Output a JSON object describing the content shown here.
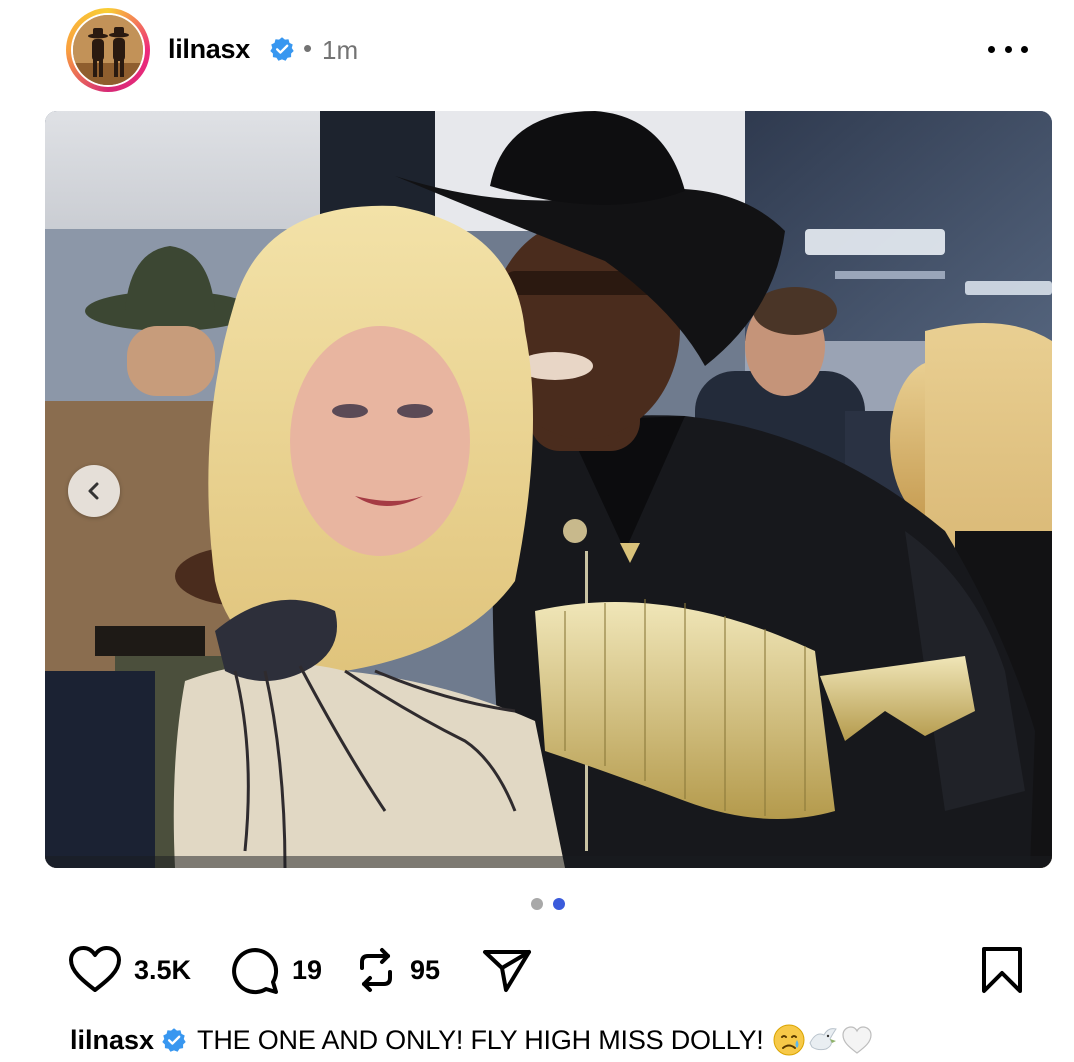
{
  "header": {
    "username": "lilnasx",
    "separator": "•",
    "time": "1m"
  },
  "carousel": {
    "total": 2,
    "current": 2
  },
  "actions": {
    "likes": "3.5K",
    "comments": "19",
    "reposts": "95"
  },
  "caption": {
    "username": "lilnasx",
    "text": "THE ONE AND ONLY! FLY HIGH MISS DOLLY!",
    "emojis": [
      "crying-face",
      "dove",
      "white-heart"
    ]
  },
  "colors": {
    "verified": "#3897f0",
    "active_dot": "#3b5bdb",
    "inactive_dot": "#a8a8a8",
    "muted_text": "#737373"
  },
  "icons": {
    "more": "more-horizontal-icon",
    "like": "heart-icon",
    "comment": "comment-icon",
    "repost": "repost-icon",
    "share": "send-icon",
    "bookmark": "bookmark-icon",
    "prev": "chevron-left-icon"
  }
}
